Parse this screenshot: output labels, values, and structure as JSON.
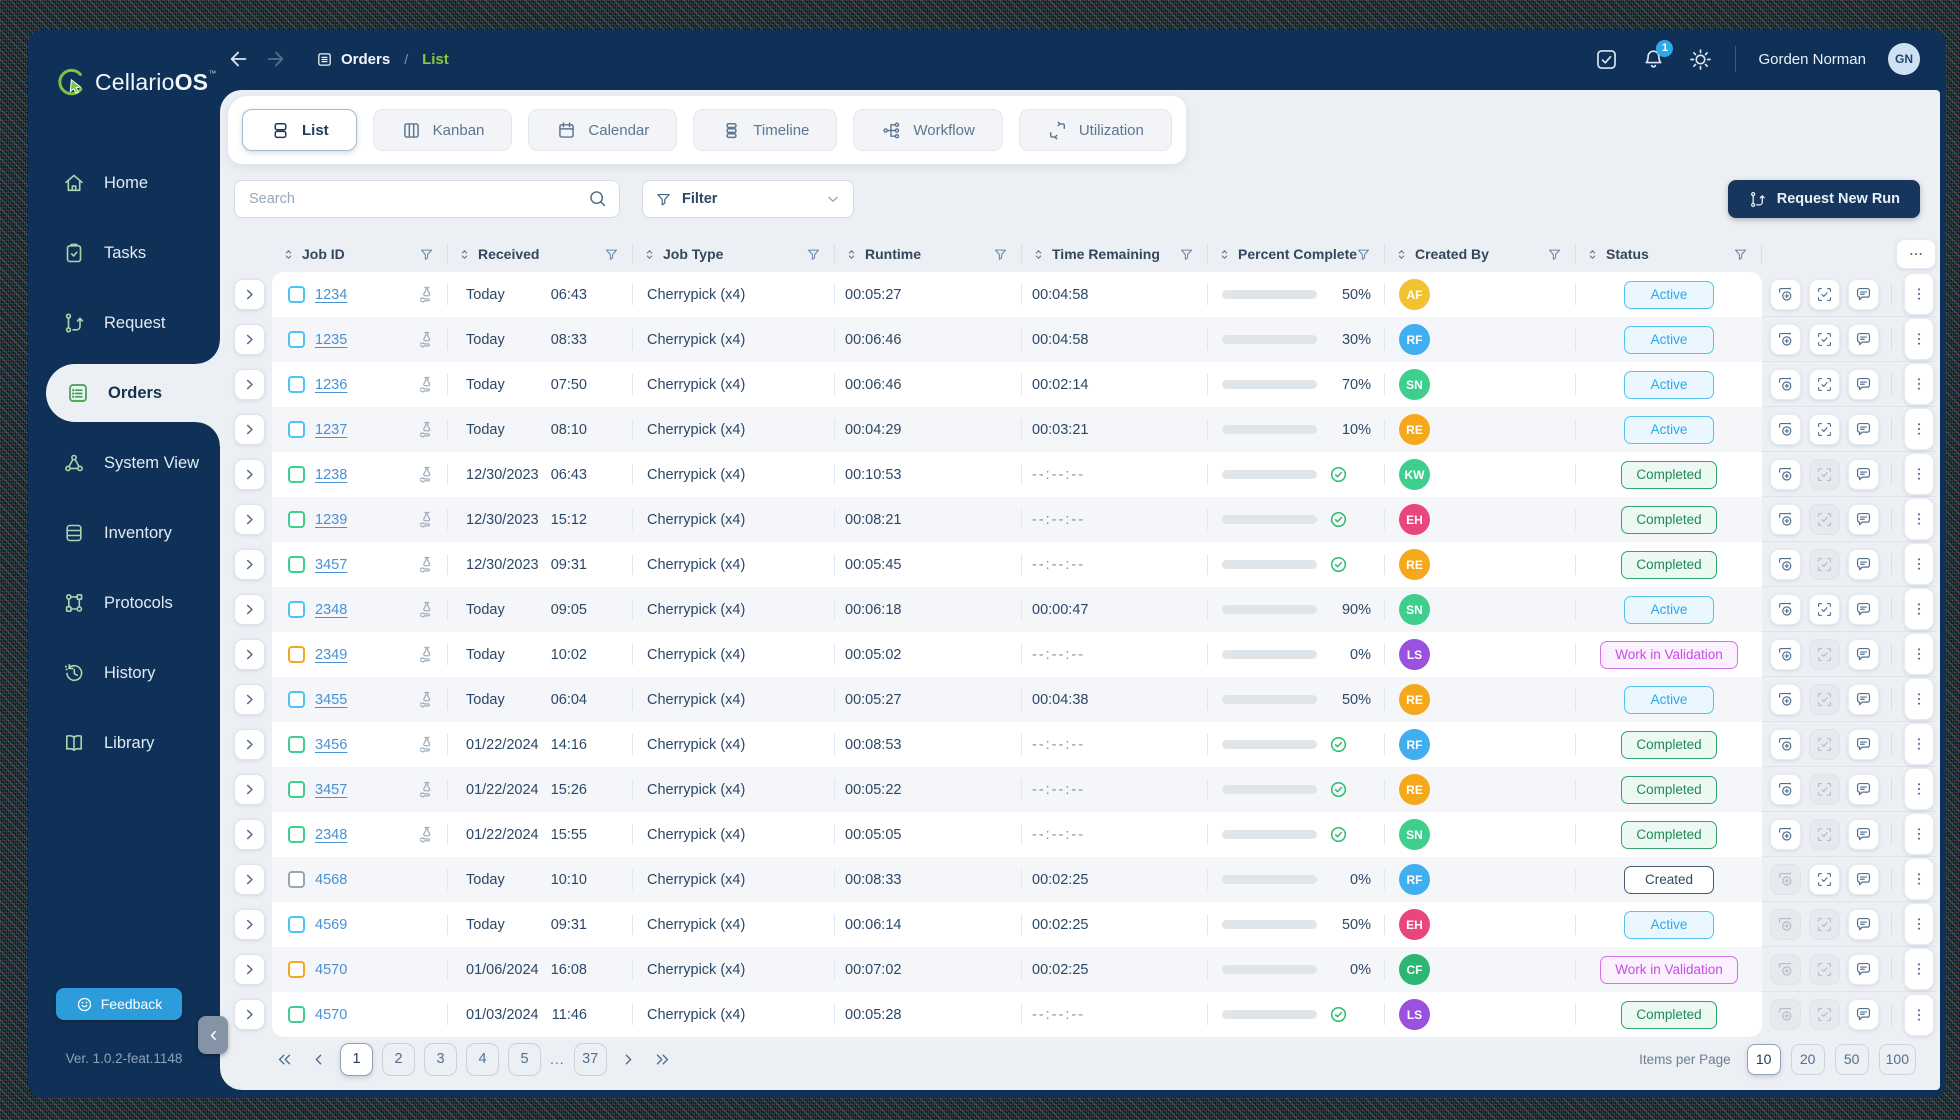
{
  "brand": {
    "name_regular": "Cellario",
    "name_bold": "OS",
    "trademark": "™"
  },
  "topbar": {
    "breadcrumb": {
      "section": "Orders",
      "separator": "/",
      "current": "List"
    },
    "notification_count": "1",
    "user": {
      "name": "Gorden Norman",
      "initials": "GN"
    }
  },
  "sidebar": {
    "items": [
      {
        "label": "Home",
        "icon": "home-icon",
        "active": false
      },
      {
        "label": "Tasks",
        "icon": "tasks-icon",
        "active": false
      },
      {
        "label": "Request",
        "icon": "request-icon",
        "active": false
      },
      {
        "label": "Orders",
        "icon": "orders-icon",
        "active": true
      },
      {
        "label": "System View",
        "icon": "system-view-icon",
        "active": false
      },
      {
        "label": "Inventory",
        "icon": "inventory-icon",
        "active": false
      },
      {
        "label": "Protocols",
        "icon": "protocols-icon",
        "active": false
      },
      {
        "label": "History",
        "icon": "history-icon",
        "active": false
      },
      {
        "label": "Library",
        "icon": "library-icon",
        "active": false
      }
    ],
    "feedback_label": "Feedback",
    "version": "Ver. 1.0.2-feat.1148"
  },
  "tabs": [
    {
      "label": "List",
      "icon": "list-tab-icon",
      "active": true
    },
    {
      "label": "Kanban",
      "icon": "kanban-icon",
      "active": false
    },
    {
      "label": "Calendar",
      "icon": "calendar-icon",
      "active": false
    },
    {
      "label": "Timeline",
      "icon": "timeline-icon",
      "active": false
    },
    {
      "label": "Workflow",
      "icon": "workflow-icon",
      "active": false
    },
    {
      "label": "Utilization",
      "icon": "utilization-icon",
      "active": false
    }
  ],
  "toolbar": {
    "search_placeholder": "Search",
    "filter_label": "Filter",
    "request_button": "Request New Run"
  },
  "table": {
    "columns": [
      {
        "label": "Job ID"
      },
      {
        "label": "Received"
      },
      {
        "label": "Job Type"
      },
      {
        "label": "Runtime"
      },
      {
        "label": "Time Remaining"
      },
      {
        "label": "Percent Complete"
      },
      {
        "label": "Created By"
      },
      {
        "label": "Status"
      }
    ],
    "rows": [
      {
        "id": "1234",
        "id_link": true,
        "checkbox": "#4FC3F7",
        "sample_icon": true,
        "date": "Today",
        "time": "06:43",
        "type": "Cherrypick (x4)",
        "runtime": "00:05:27",
        "remaining": "00:04:58",
        "percent": 50,
        "percent_label": "50%",
        "completed": false,
        "avatar": {
          "initials": "AF",
          "color": "#F2C230"
        },
        "status": {
          "label": "Active",
          "type": "active"
        },
        "actions": [
          true,
          true,
          true
        ]
      },
      {
        "id": "1235",
        "id_link": true,
        "checkbox": "#4FC3F7",
        "sample_icon": true,
        "date": "Today",
        "time": "08:33",
        "type": "Cherrypick (x4)",
        "runtime": "00:06:46",
        "remaining": "00:04:58",
        "percent": 30,
        "percent_label": "30%",
        "completed": false,
        "avatar": {
          "initials": "RF",
          "color": "#41AEF0"
        },
        "status": {
          "label": "Active",
          "type": "active"
        },
        "actions": [
          true,
          true,
          true
        ]
      },
      {
        "id": "1236",
        "id_link": true,
        "checkbox": "#4FC3F7",
        "sample_icon": true,
        "date": "Today",
        "time": "07:50",
        "type": "Cherrypick (x4)",
        "runtime": "00:06:46",
        "remaining": "00:02:14",
        "percent": 70,
        "percent_label": "70%",
        "completed": false,
        "avatar": {
          "initials": "SN",
          "color": "#3ECF8E"
        },
        "status": {
          "label": "Active",
          "type": "active"
        },
        "actions": [
          true,
          true,
          true
        ]
      },
      {
        "id": "1237",
        "id_link": true,
        "checkbox": "#4FC3F7",
        "sample_icon": true,
        "date": "Today",
        "time": "08:10",
        "type": "Cherrypick (x4)",
        "runtime": "00:04:29",
        "remaining": "00:03:21",
        "percent": 10,
        "percent_label": "10%",
        "completed": false,
        "avatar": {
          "initials": "RE",
          "color": "#F5A81C"
        },
        "status": {
          "label": "Active",
          "type": "active"
        },
        "actions": [
          true,
          true,
          true
        ]
      },
      {
        "id": "1238",
        "id_link": true,
        "checkbox": "#3ECF8E",
        "sample_icon": true,
        "date": "12/30/2023",
        "time": "06:43",
        "type": "Cherrypick (x4)",
        "runtime": "00:10:53",
        "remaining": "--:--:--",
        "percent": 100,
        "percent_label": null,
        "completed": true,
        "avatar": {
          "initials": "KW",
          "color": "#3ECF8E"
        },
        "status": {
          "label": "Completed",
          "type": "completed"
        },
        "actions": [
          true,
          false,
          true
        ]
      },
      {
        "id": "1239",
        "id_link": true,
        "checkbox": "#3ECF8E",
        "sample_icon": true,
        "date": "12/30/2023",
        "time": "15:12",
        "type": "Cherrypick (x4)",
        "runtime": "00:08:21",
        "remaining": "--:--:--",
        "percent": 100,
        "percent_label": null,
        "completed": true,
        "avatar": {
          "initials": "EH",
          "color": "#E8467C"
        },
        "status": {
          "label": "Completed",
          "type": "completed"
        },
        "actions": [
          true,
          false,
          true
        ]
      },
      {
        "id": "3457",
        "id_link": true,
        "checkbox": "#3ECF8E",
        "sample_icon": true,
        "date": "12/30/2023",
        "time": "09:31",
        "type": "Cherrypick (x4)",
        "runtime": "00:05:45",
        "remaining": "--:--:--",
        "percent": 100,
        "percent_label": null,
        "completed": true,
        "avatar": {
          "initials": "RE",
          "color": "#F5A81C"
        },
        "status": {
          "label": "Completed",
          "type": "completed"
        },
        "actions": [
          true,
          false,
          true
        ]
      },
      {
        "id": "2348",
        "id_link": true,
        "checkbox": "#4FC3F7",
        "sample_icon": true,
        "date": "Today",
        "time": "09:05",
        "type": "Cherrypick (x4)",
        "runtime": "00:06:18",
        "remaining": "00:00:47",
        "percent": 90,
        "percent_label": "90%",
        "completed": false,
        "avatar": {
          "initials": "SN",
          "color": "#3ECF8E"
        },
        "status": {
          "label": "Active",
          "type": "active"
        },
        "actions": [
          true,
          true,
          true
        ]
      },
      {
        "id": "2349",
        "id_link": true,
        "checkbox": "#F5A623",
        "sample_icon": true,
        "date": "Today",
        "time": "10:02",
        "type": "Cherrypick (x4)",
        "runtime": "00:05:02",
        "remaining": "--:--:--",
        "percent": 0,
        "percent_label": "0%",
        "completed": false,
        "avatar": {
          "initials": "LS",
          "color": "#9B51E0"
        },
        "status": {
          "label": "Work in Validation",
          "type": "wiv"
        },
        "actions": [
          true,
          false,
          true
        ]
      },
      {
        "id": "3455",
        "id_link": true,
        "checkbox": "#4FC3F7",
        "sample_icon": true,
        "date": "Today",
        "time": "06:04",
        "type": "Cherrypick (x4)",
        "runtime": "00:05:27",
        "remaining": "00:04:38",
        "percent": 50,
        "percent_label": "50%",
        "completed": false,
        "avatar": {
          "initials": "RE",
          "color": "#F5A81C"
        },
        "status": {
          "label": "Active",
          "type": "active"
        },
        "actions": [
          true,
          false,
          true
        ]
      },
      {
        "id": "3456",
        "id_link": true,
        "checkbox": "#3ECF8E",
        "sample_icon": true,
        "date": "01/22/2024",
        "time": "14:16",
        "type": "Cherrypick (x4)",
        "runtime": "00:08:53",
        "remaining": "--:--:--",
        "percent": 100,
        "percent_label": null,
        "completed": true,
        "avatar": {
          "initials": "RF",
          "color": "#41AEF0"
        },
        "status": {
          "label": "Completed",
          "type": "completed"
        },
        "actions": [
          true,
          false,
          true
        ]
      },
      {
        "id": "3457",
        "id_link": true,
        "checkbox": "#3ECF8E",
        "sample_icon": true,
        "date": "01/22/2024",
        "time": "15:26",
        "type": "Cherrypick (x4)",
        "runtime": "00:05:22",
        "remaining": "--:--:--",
        "percent": 100,
        "percent_label": null,
        "completed": true,
        "avatar": {
          "initials": "RE",
          "color": "#F5A81C"
        },
        "status": {
          "label": "Completed",
          "type": "completed"
        },
        "actions": [
          true,
          false,
          true
        ]
      },
      {
        "id": "2348",
        "id_link": true,
        "checkbox": "#3ECF8E",
        "sample_icon": true,
        "date": "01/22/2024",
        "time": "15:55",
        "type": "Cherrypick (x4)",
        "runtime": "00:05:05",
        "remaining": "--:--:--",
        "percent": 100,
        "percent_label": null,
        "completed": true,
        "avatar": {
          "initials": "SN",
          "color": "#3ECF8E"
        },
        "status": {
          "label": "Completed",
          "type": "completed"
        },
        "actions": [
          true,
          false,
          true
        ]
      },
      {
        "id": "4568",
        "id_link": false,
        "checkbox": "#9AA5B1",
        "sample_icon": false,
        "date": "Today",
        "time": "10:10",
        "type": "Cherrypick (x4)",
        "runtime": "00:08:33",
        "remaining": "00:02:25",
        "percent": 0,
        "percent_label": "0%",
        "completed": false,
        "avatar": {
          "initials": "RF",
          "color": "#41AEF0"
        },
        "status": {
          "label": "Created",
          "type": "created"
        },
        "actions": [
          false,
          true,
          true
        ]
      },
      {
        "id": "4569",
        "id_link": false,
        "checkbox": "#4FC3F7",
        "sample_icon": false,
        "date": "Today",
        "time": "09:31",
        "type": "Cherrypick (x4)",
        "runtime": "00:06:14",
        "remaining": "00:02:25",
        "percent": 50,
        "percent_label": "50%",
        "completed": false,
        "avatar": {
          "initials": "EH",
          "color": "#E8467C"
        },
        "status": {
          "label": "Active",
          "type": "active"
        },
        "actions": [
          false,
          false,
          true
        ]
      },
      {
        "id": "4570",
        "id_link": false,
        "checkbox": "#F5A623",
        "sample_icon": false,
        "date": "01/06/2024",
        "time": "16:08",
        "type": "Cherrypick (x4)",
        "runtime": "00:07:02",
        "remaining": "00:02:25",
        "percent": 0,
        "percent_label": "0%",
        "completed": false,
        "avatar": {
          "initials": "CF",
          "color": "#2BB673"
        },
        "status": {
          "label": "Work in Validation",
          "type": "wiv"
        },
        "actions": [
          false,
          false,
          true
        ]
      },
      {
        "id": "4570",
        "id_link": false,
        "checkbox": "#3ECF8E",
        "sample_icon": false,
        "date": "01/03/2024",
        "time": "11:46",
        "type": "Cherrypick (x4)",
        "runtime": "00:05:28",
        "remaining": "--:--:--",
        "percent": 100,
        "percent_label": null,
        "completed": true,
        "avatar": {
          "initials": "LS",
          "color": "#9B51E0"
        },
        "status": {
          "label": "Completed",
          "type": "completed"
        },
        "actions": [
          false,
          false,
          true
        ]
      }
    ]
  },
  "pagination": {
    "pages": [
      "1",
      "2",
      "3",
      "4",
      "5"
    ],
    "ellipsis": "...",
    "last_page": "37",
    "active_page": "1",
    "items_per_page_label": "Items per Page",
    "page_sizes": [
      "10",
      "20",
      "50",
      "100"
    ],
    "active_size": "10"
  },
  "icons": {
    "row_actions": [
      "schedule-add-icon",
      "validate-icon",
      "comment-icon",
      "kebab-icon"
    ],
    "topbar": [
      "task-check-icon",
      "bell-icon",
      "gear-icon"
    ]
  },
  "colors": {
    "navy": "#0F3158",
    "panel": "#ECEFF4",
    "accent_green": "#7DC242",
    "link_blue": "#4A90D2",
    "active_blue": "#4FC3F7",
    "progress_blue": "#4DB8EA",
    "progress_track": "#E0E5EA",
    "completed_green": "#2EBD6B",
    "wiv_magenta": "#C44FE0",
    "created_dark": "#33475C",
    "feedback_blue": "#2D9CDB",
    "notification_blue": "#2FA8E8"
  }
}
